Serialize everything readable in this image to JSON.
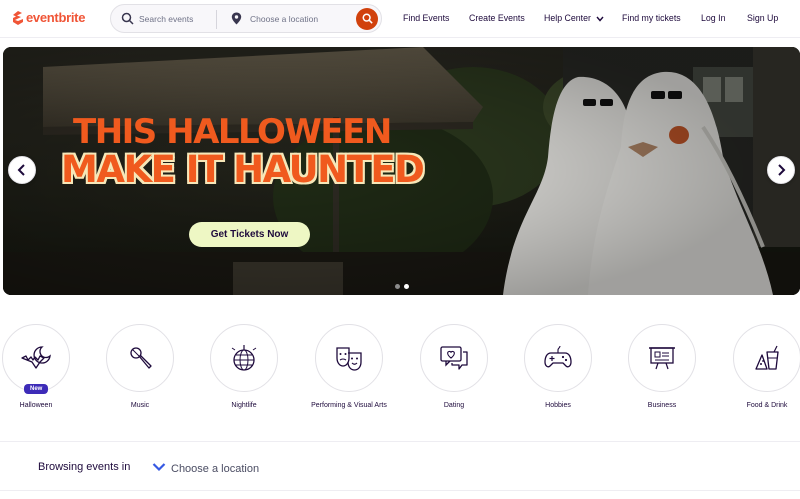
{
  "brand": {
    "name": "eventbrite",
    "color": "#f05537"
  },
  "search": {
    "placeholder": "Search events",
    "location_placeholder": "Choose a location",
    "button_color": "#d1410c"
  },
  "nav": {
    "find_events": "Find Events",
    "create_events": "Create Events",
    "help_center": "Help Center",
    "find_tickets": "Find my tickets",
    "log_in": "Log In",
    "sign_up": "Sign Up"
  },
  "hero": {
    "title_line1": "THIS HALLOWEEN",
    "title_line2": "MAKE IT HAUNTED",
    "cta": "Get Tickets Now",
    "slide_count": 2,
    "active_slide": 2
  },
  "categories": [
    {
      "label": "Halloween",
      "icon": "bat-moon-icon",
      "badge": "New"
    },
    {
      "label": "Music",
      "icon": "microphone-icon"
    },
    {
      "label": "Nightlife",
      "icon": "disco-ball-icon"
    },
    {
      "label": "Performing & Visual Arts",
      "icon": "theater-masks-icon"
    },
    {
      "label": "Dating",
      "icon": "chat-heart-icon"
    },
    {
      "label": "Hobbies",
      "icon": "game-controller-icon"
    },
    {
      "label": "Business",
      "icon": "presentation-board-icon"
    },
    {
      "label": "Food & Drink",
      "icon": "food-drink-icon"
    }
  ],
  "browse": {
    "label": "Browsing events in",
    "location": "Choose a location"
  }
}
